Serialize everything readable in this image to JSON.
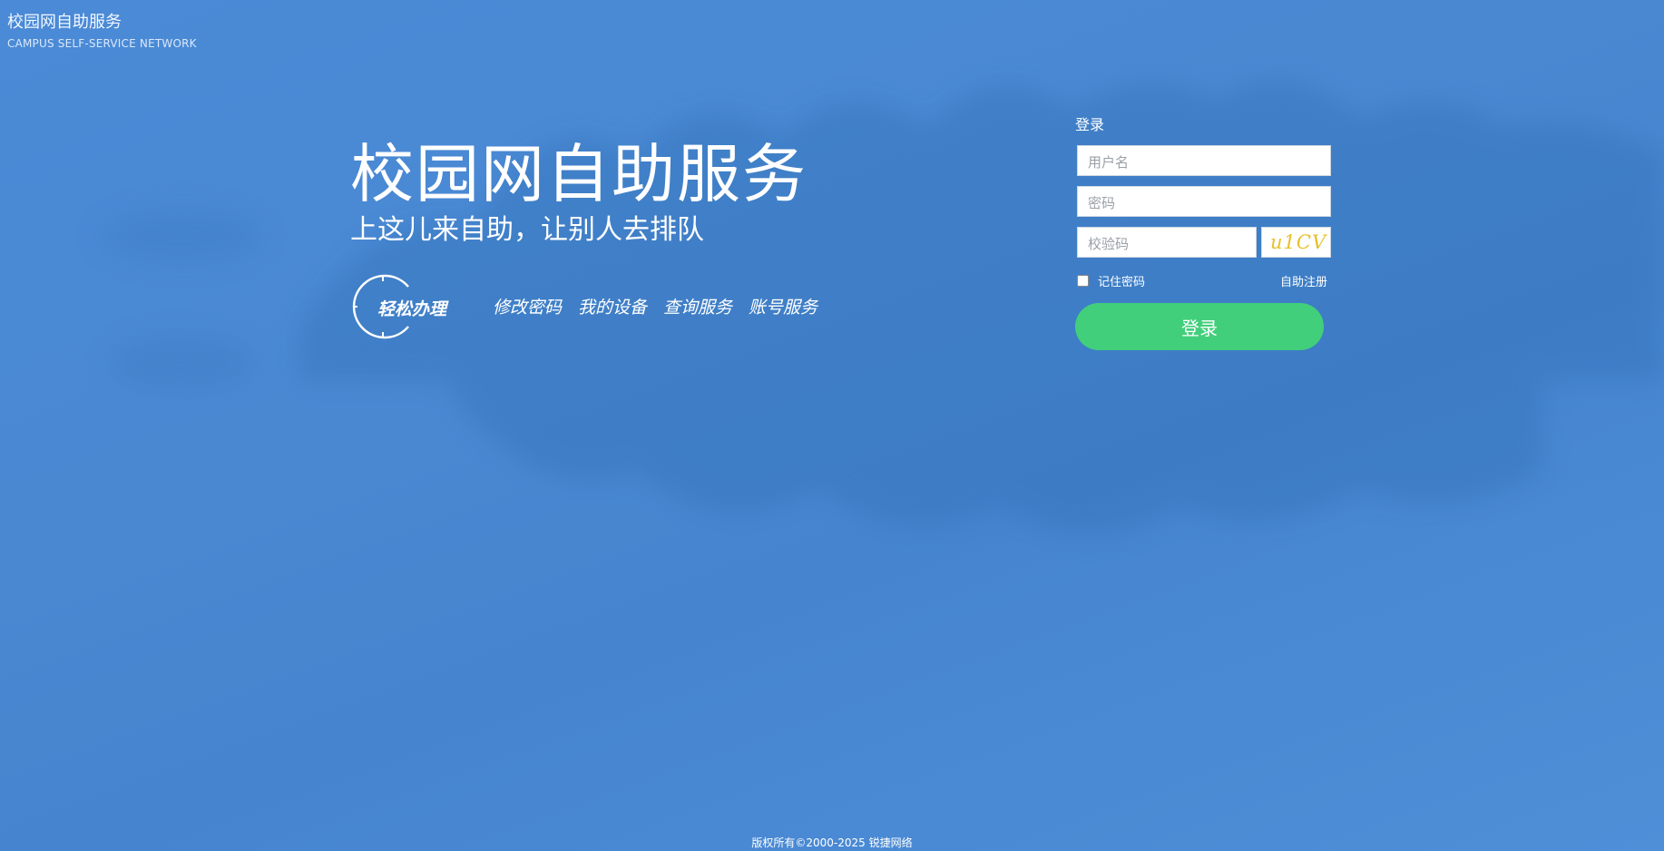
{
  "colors": {
    "background": "#4a88d2",
    "button": "#42cf7b",
    "captcha_text": "#e6c12a",
    "text": "#ffffff"
  },
  "brand": {
    "title": "校园网自助服务",
    "subtitle": "CAMPUS  SELF-SERVICE NETWORK"
  },
  "hero": {
    "title": "校园网自助服务",
    "slogan": "上这儿来自助，让别人去排队"
  },
  "quick": {
    "badge": "轻松办理",
    "badge_icon": "circle-arc-icon",
    "links": [
      "修改密码",
      "我的设备",
      "查询服务",
      "账号服务"
    ]
  },
  "login": {
    "title": "登录",
    "username_placeholder": "用户名",
    "password_placeholder": "密码",
    "captcha_placeholder": "校验码",
    "captcha_image_text": "u1CV",
    "remember_label": "记住密码",
    "remember_checked": false,
    "register_link": "自助注册",
    "submit_label": "登录"
  },
  "footer": {
    "copyright": "版权所有©2000-2025 锐捷网络"
  }
}
